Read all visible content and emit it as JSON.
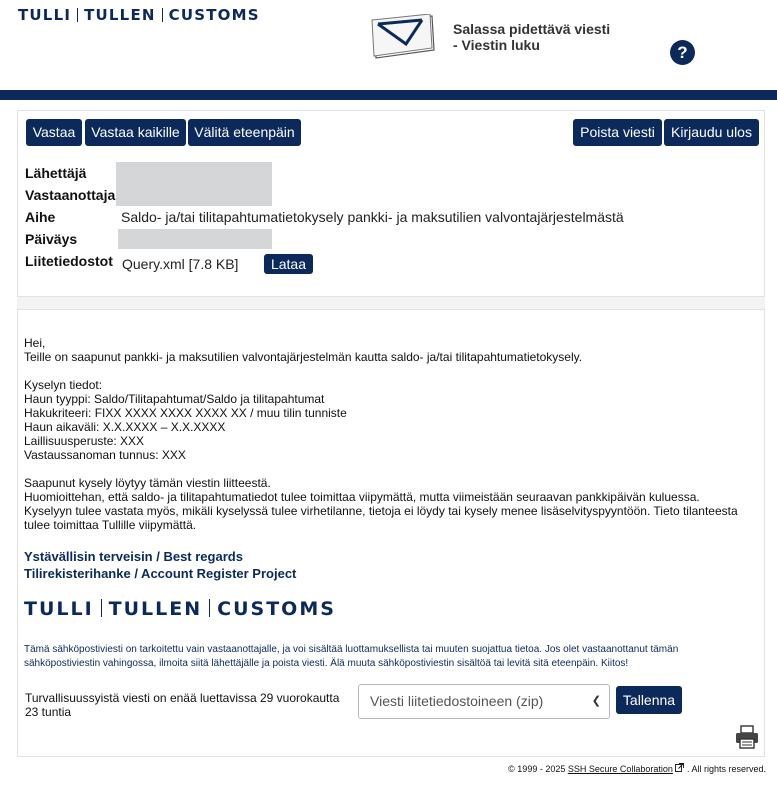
{
  "header": {
    "brand": [
      "TULLI",
      "TULLEN",
      "CUSTOMS"
    ],
    "title_line1": "Salassa pidettävä viesti",
    "title_line2": "- Viestin luku",
    "help": "?"
  },
  "toolbar": {
    "reply": "Vastaa",
    "reply_all": "Vastaa kaikille",
    "forward": "Välitä eteenpäin",
    "delete": "Poista viesti",
    "logout": "Kirjaudu ulos"
  },
  "fields": {
    "sender_label": "Lähettäjä",
    "recipient_label": "Vastaanottaja",
    "subject_label": "Aihe",
    "subject": "Saldo- ja/tai tilitapahtumatietokysely pankki- ja maksutilien valvontajärjestelmästä",
    "date_label": "Päiväys",
    "attachments_label": "Liitetiedostot",
    "attachment": "Query.xml [7.8 KB]",
    "download": "Lataa"
  },
  "message": {
    "lines": [
      "Hei,",
      "Teille on saapunut pankki- ja maksutilien valvontajärjestelmän kautta saldo- ja/tai tilitapahtumatietokysely.",
      "",
      "Kyselyn tiedot:",
      "Haun tyyppi: Saldo/Tilitapahtumat/Saldo ja tilitapahtumat",
      "Hakukriteeri: FIXX XXXX XXXX XXXX XX / muu tilin tunniste",
      "Haun aikaväli: X.X.XXXX – X.X.XXXX",
      "Laillisuusperuste: XXX",
      "Vastaussanoman tunnus: XXX",
      "",
      "Saapunut kysely löytyy tämän viestin liitteestä.",
      "Huomioittehan, että saldo- ja tilitapahtumatiedot tulee toimittaa viipymättä, mutta viimeistään seuraavan pankkipäivän kuluessa.",
      "Kyselyyn tulee vastata myös, mikäli kyselyssä tulee virhetilanne, tietoja ei löydy tai kysely menee lisäselvityspyyntöön. Tieto tilanteesta",
      "tulee toimittaa Tullille viipymättä."
    ],
    "regards1": "Ystävällisin terveisin / Best regards",
    "regards2": "Tilirekisterihanke / Account Register Project",
    "brand": [
      "TULLI",
      "TULLEN",
      "CUSTOMS"
    ],
    "disclaimer": "Tämä sähköpostiviesti on tarkoitettu vain vastaanottajalle, ja voi sisältää luottamuksellista tai muuten suojattua tietoa. Jos olet vastaanottanut tämän sähköpostiviestin vahingossa, ilmoita siitä lähettäjälle ja poista viesti. Älä muuta sähköpostiviestin sisältöä tai levitä sitä eteenpäin. Kiitos!"
  },
  "save": {
    "availability": "Turvallisuussyistä viesti on enää luettavissa 29 vuorokautta 23 tuntia",
    "select_value": "Viesti liitetiedostoineen (zip)",
    "save_button": "Tallenna"
  },
  "footer": {
    "copyright": "© 1999 - 2025",
    "link": "SSH Secure Collaboration",
    "rights": ". All rights reserved."
  },
  "colors": {
    "brand_navy": "#0b2a5b",
    "redaction": "#d5d6d8"
  }
}
